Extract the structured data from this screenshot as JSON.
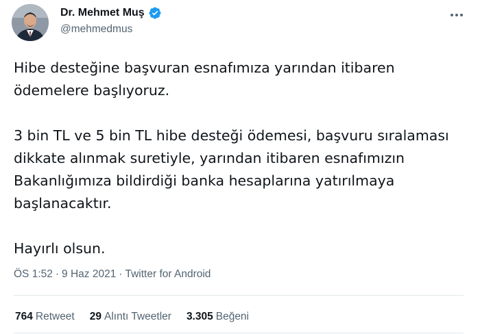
{
  "author": {
    "display_name": "Dr. Mehmet Muş",
    "handle": "@mehmedmus",
    "verified_icon": "verified-badge-icon",
    "verified_color": "#1d9bf0"
  },
  "tweet": {
    "paragraphs": [
      "Hibe desteğine başvuran esnafımıza yarından itibaren ödemelere başlıyoruz.",
      "3 bin TL ve 5 bin TL hibe desteği ödemesi, başvuru sıralaması dikkate alınmak suretiyle, yarından itibaren esnafımızın Bakanlığımıza bildirdiği banka hesaplarına yatırılmaya başlanacaktır.",
      "Hayırlı olsun."
    ],
    "time": "ÖS 1:52",
    "date": "9 Haz 2021",
    "source": "Twitter for Android",
    "separator": "·"
  },
  "stats": {
    "retweets": {
      "count": "764",
      "label": "Retweet"
    },
    "quotes": {
      "count": "29",
      "label": "Alıntı Tweetler"
    },
    "likes": {
      "count": "3.305",
      "label": "Beğeni"
    }
  },
  "colors": {
    "text": "#0f1419",
    "secondary": "#536471",
    "divider": "#e3e7ea"
  }
}
